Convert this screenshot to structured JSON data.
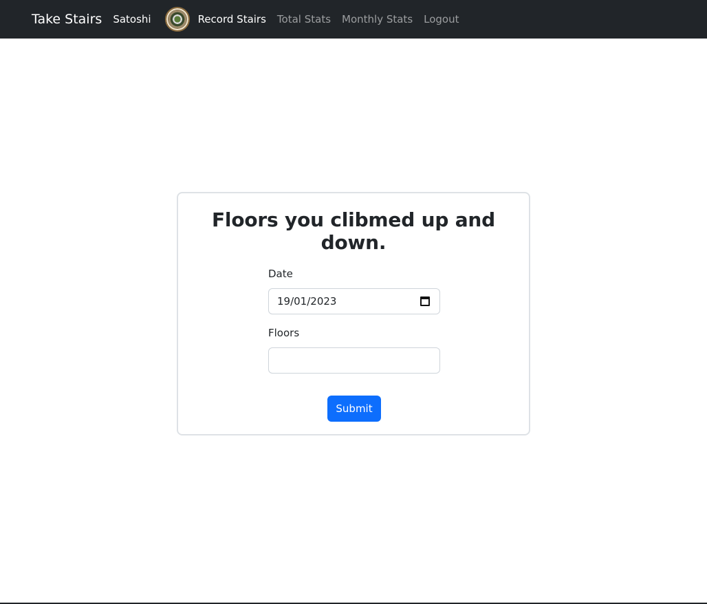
{
  "navbar": {
    "brand": "Take Stairs",
    "username": "Satoshi",
    "avatar_icon": "user-avatar",
    "links": [
      {
        "label": "Record Stairs",
        "active": true
      },
      {
        "label": "Total Stats",
        "active": false
      },
      {
        "label": "Monthly Stats",
        "active": false
      },
      {
        "label": "Logout",
        "active": false
      }
    ],
    "background": "#212529"
  },
  "form": {
    "title": "Floors you clibmed up and down.",
    "date_label": "Date",
    "date_value": "19/01/2023",
    "floors_label": "Floors",
    "floors_value": "",
    "submit_label": "Submit",
    "submit_color": "#0d6efd"
  }
}
